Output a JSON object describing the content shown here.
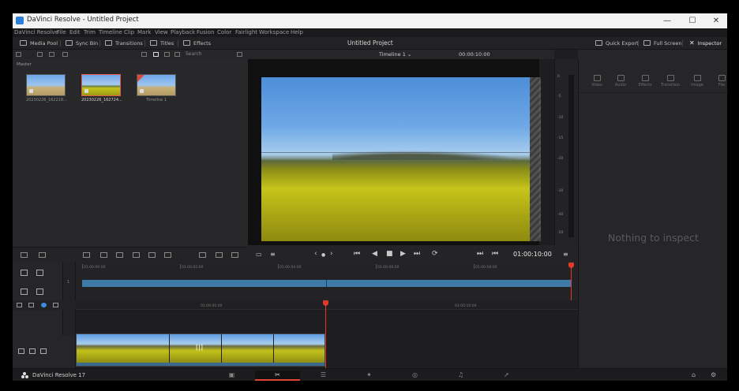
{
  "window": {
    "title": "DaVinci Resolve - Untitled Project",
    "controls": {
      "minimize": "—",
      "maximize": "☐",
      "close": "✕"
    }
  },
  "menu": [
    "DaVinci Resolve",
    "File",
    "Edit",
    "Trim",
    "Timeline",
    "Clip",
    "Mark",
    "View",
    "Playback",
    "Fusion",
    "Color",
    "Fairlight",
    "Workspace",
    "Help"
  ],
  "toolbar": {
    "media_pool": "Media Pool",
    "sync_bin": "Sync Bin",
    "transitions": "Transitions",
    "titles": "Titles",
    "effects": "Effects",
    "project_title": "Untitled Project",
    "quick_export": "Quick Export",
    "full_screen": "Full Screen",
    "inspector": "Inspector"
  },
  "media_pool": {
    "search_placeholder": "Search",
    "bin_label": "Master",
    "clips": [
      {
        "name": "20230226_162218...",
        "selected": false,
        "kind": "video"
      },
      {
        "name": "20230226_162724...",
        "selected": true,
        "kind": "video"
      },
      {
        "name": "Timeline 1",
        "selected": false,
        "kind": "timeline"
      }
    ]
  },
  "viewer": {
    "timeline_name": "Timeline 1",
    "header_timecode": "00:00:10:00",
    "playback_timecode": "01:00:10:00",
    "transport": {
      "first": "⏮",
      "reverse": "◀",
      "stop": "■",
      "play": "▶",
      "last": "⏭",
      "loop": "⟳"
    },
    "nav": {
      "prev": "‹",
      "dot": "●",
      "next": "›"
    }
  },
  "audio_meter": {
    "ticks": [
      "0",
      "-5",
      "-10",
      "-15",
      "-20",
      "-30",
      "-40",
      "-50"
    ]
  },
  "inspector": {
    "tabs": [
      "Video",
      "Audio",
      "Effects",
      "Transition",
      "Image",
      "File"
    ],
    "empty_text": "Nothing to inspect"
  },
  "upper_timeline": {
    "ruler": [
      "01:00:00:00",
      "01:00:02:00",
      "01:00:04:00",
      "01:00:06:00",
      "01:00:08:00",
      "01:00:10:00"
    ],
    "track_number": "1"
  },
  "lower_timeline": {
    "ruler": [
      "01:00:00:00",
      "01:00:10:00"
    ],
    "track_number": "1",
    "cursor": "[|]"
  },
  "bottom_bar": {
    "app_name": "DaVinci Resolve 17",
    "pages": [
      {
        "name": "media-page",
        "glyph": "▣",
        "active": false
      },
      {
        "name": "cut-page",
        "glyph": "✂",
        "active": true
      },
      {
        "name": "edit-page",
        "glyph": "☰",
        "active": false
      },
      {
        "name": "fusion-page",
        "glyph": "✦",
        "active": false
      },
      {
        "name": "color-page",
        "glyph": "◎",
        "active": false
      },
      {
        "name": "fairlight-page",
        "glyph": "♫",
        "active": false
      },
      {
        "name": "deliver-page",
        "glyph": "➚",
        "active": false
      }
    ],
    "home": "⌂",
    "settings": "⚙"
  },
  "colors": {
    "accent": "#e04533",
    "playhead": "#e03a2a",
    "clip_blue": "#3e7ba9"
  }
}
